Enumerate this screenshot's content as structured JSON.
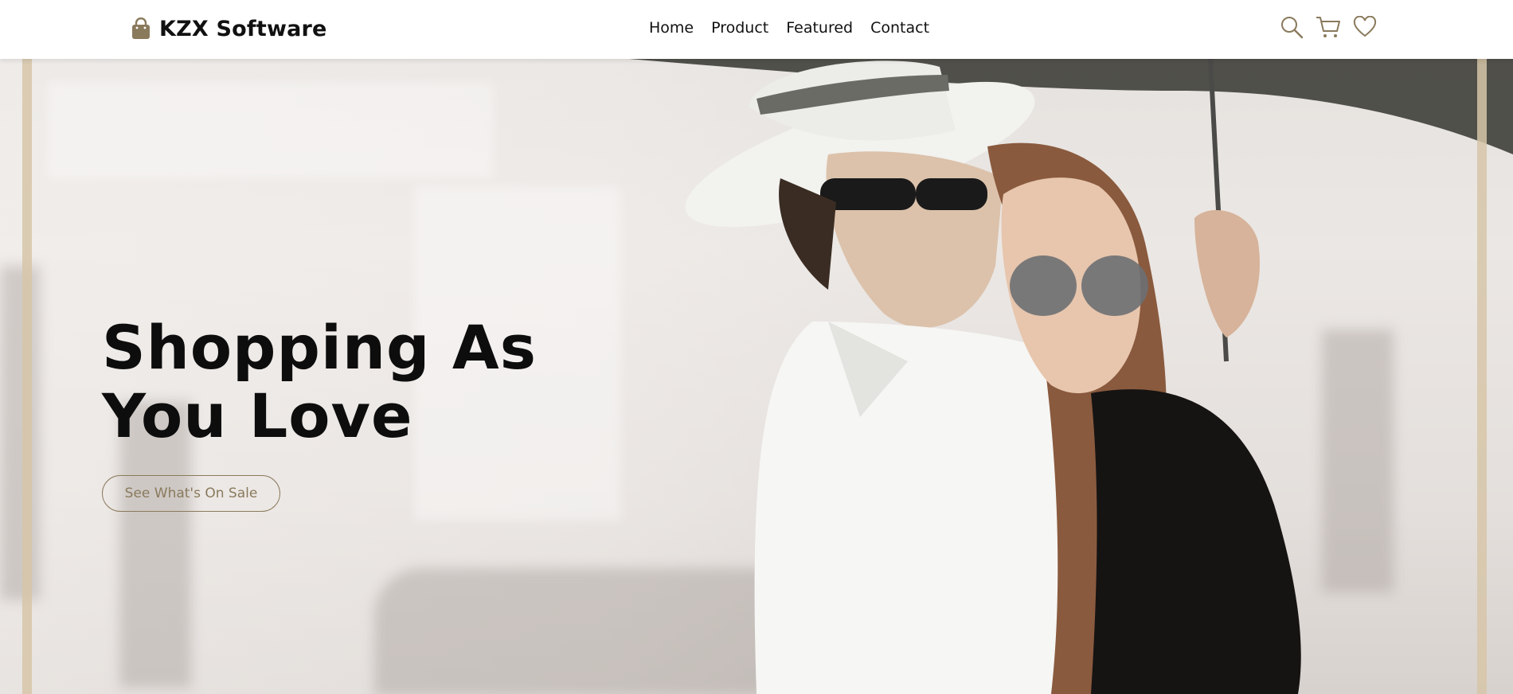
{
  "header": {
    "brand_icon": "shopping-bag-icon",
    "brand_name": "KZX Software",
    "nav": [
      {
        "label": "Home"
      },
      {
        "label": "Product"
      },
      {
        "label": "Featured"
      },
      {
        "label": "Contact"
      }
    ],
    "actions": [
      {
        "name": "search-icon"
      },
      {
        "name": "cart-icon"
      },
      {
        "name": "heart-icon"
      }
    ]
  },
  "hero": {
    "title_line1": "Shopping As",
    "title_line2": "You Love",
    "cta_label": "See What's On Sale",
    "image_description_icon": "couple-photo"
  },
  "colors": {
    "accent": "#8a7a5c",
    "frame": "#d6c6a8",
    "brand_icon": "#8a7a5c",
    "text": "#111111"
  }
}
